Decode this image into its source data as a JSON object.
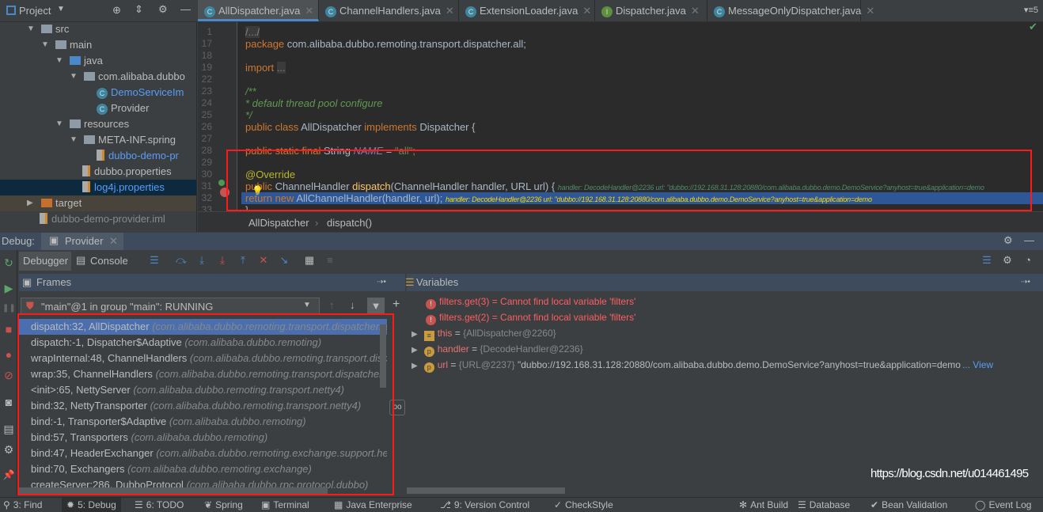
{
  "project": {
    "title": "Project",
    "tree": [
      {
        "label": "src",
        "indent": 1,
        "icon": "folder",
        "open": true
      },
      {
        "label": "main",
        "indent": 2,
        "icon": "folder",
        "open": true
      },
      {
        "label": "java",
        "indent": 3,
        "icon": "folder-blue",
        "open": true
      },
      {
        "label": "com.alibaba.dubbo",
        "indent": 4,
        "icon": "package",
        "open": true
      },
      {
        "label": "DemoServiceIm",
        "indent": 5,
        "icon": "class",
        "color": "#589df6"
      },
      {
        "label": "Provider",
        "indent": 5,
        "icon": "class"
      },
      {
        "label": "resources",
        "indent": 3,
        "icon": "folder",
        "open": true
      },
      {
        "label": "META-INF.spring",
        "indent": 4,
        "icon": "package",
        "open": true
      },
      {
        "label": "dubbo-demo-pr",
        "indent": 5,
        "icon": "xml",
        "color": "#589df6"
      },
      {
        "label": "dubbo.properties",
        "indent": 4,
        "icon": "properties"
      },
      {
        "label": "log4j.properties",
        "indent": 4,
        "icon": "properties",
        "selected": true,
        "color": "#589df6"
      },
      {
        "label": "target",
        "indent": 1,
        "icon": "folder-orange",
        "open": false,
        "excluded": true
      },
      {
        "label": "dubbo-demo-provider.iml",
        "indent": 1,
        "icon": "file",
        "color": "#888"
      }
    ]
  },
  "editor": {
    "tabs": [
      {
        "label": "AllDispatcher.java",
        "active": true
      },
      {
        "label": "ChannelHandlers.java"
      },
      {
        "label": "ExtensionLoader.java"
      },
      {
        "label": "Dispatcher.java",
        "interface": true
      },
      {
        "label": "MessageOnlyDispatcher.java"
      }
    ],
    "tab_count": "5",
    "lines": [
      {
        "n": "1",
        "tokens": [
          [
            "fold",
            "/.../"
          ]
        ]
      },
      {
        "n": "17",
        "tokens": [
          [
            "kw",
            "package "
          ],
          [
            "pl",
            "com.alibaba.dubbo.remoting.transport.dispatcher.all;"
          ]
        ]
      },
      {
        "n": "18",
        "tokens": []
      },
      {
        "n": "19",
        "tokens": [
          [
            "kw",
            "import "
          ],
          [
            "fold",
            "..."
          ]
        ]
      },
      {
        "n": "22",
        "tokens": []
      },
      {
        "n": "23",
        "tokens": [
          [
            "cm",
            "/**"
          ]
        ]
      },
      {
        "n": "24",
        "tokens": [
          [
            "cm",
            " * default thread pool configure"
          ]
        ]
      },
      {
        "n": "25",
        "tokens": [
          [
            "cm",
            " */"
          ]
        ]
      },
      {
        "n": "26",
        "tokens": [
          [
            "kw",
            "public class "
          ],
          [
            "pl",
            "AllDispatcher "
          ],
          [
            "kw",
            "implements "
          ],
          [
            "pl",
            "Dispatcher {"
          ]
        ]
      },
      {
        "n": "27",
        "tokens": []
      },
      {
        "n": "28",
        "tokens": [
          [
            "kw",
            "    public static final "
          ],
          [
            "pl",
            "String "
          ],
          [
            "it",
            "NAME"
          ],
          [
            "pl",
            " = "
          ],
          [
            "str",
            "\"all\""
          ],
          [
            "kw",
            ";"
          ]
        ]
      },
      {
        "n": "29",
        "tokens": []
      },
      {
        "n": "30",
        "tokens": [
          [
            "an",
            "    @Override"
          ]
        ]
      },
      {
        "n": "31",
        "tokens": [
          [
            "kw",
            "    public "
          ],
          [
            "pl",
            "ChannelHandler "
          ],
          [
            "fn",
            "dispatch"
          ],
          [
            "pl",
            "(ChannelHandler handler, URL url) {  "
          ],
          [
            "inl",
            "handler: DecodeHandler@2236  url: \"dubbo://192.168.31.128:20880/com.alibaba.dubbo.demo.DemoService?anyhost=true&application=demo"
          ]
        ]
      },
      {
        "n": "32",
        "highlight": true,
        "tokens": [
          [
            "kw",
            "        return new "
          ],
          [
            "pl",
            "AllChannelHandler(handler, url);  "
          ],
          [
            "inly",
            "handler: DecodeHandler@2236  url: \"dubbo://192.168.31.128:20880/com.alibaba.dubbo.demo.DemoService?anyhost=true&application=demo"
          ]
        ]
      },
      {
        "n": "33",
        "tokens": [
          [
            "pl",
            "    }"
          ]
        ]
      }
    ],
    "breadcrumb": [
      "AllDispatcher",
      "dispatch()"
    ]
  },
  "debug": {
    "label": "Debug:",
    "config_tab": "Provider",
    "tabs": {
      "debugger": "Debugger",
      "console": "Console"
    },
    "frames": {
      "title": "Frames",
      "thread": "\"main\"@1 in group \"main\": RUNNING",
      "items": [
        {
          "method": "dispatch:32, AllDispatcher",
          "pkg": "(com.alibaba.dubbo.remoting.transport.dispatcher.all)",
          "selected": true
        },
        {
          "method": "dispatch:-1, Dispatcher$Adaptive",
          "pkg": "(com.alibaba.dubbo.remoting)"
        },
        {
          "method": "wrapInternal:48, ChannelHandlers",
          "pkg": "(com.alibaba.dubbo.remoting.transport.dispatcher)"
        },
        {
          "method": "wrap:35, ChannelHandlers",
          "pkg": "(com.alibaba.dubbo.remoting.transport.dispatcher)"
        },
        {
          "method": "<init>:65, NettyServer",
          "pkg": "(com.alibaba.dubbo.remoting.transport.netty4)"
        },
        {
          "method": "bind:32, NettyTransporter",
          "pkg": "(com.alibaba.dubbo.remoting.transport.netty4)"
        },
        {
          "method": "bind:-1, Transporter$Adaptive",
          "pkg": "(com.alibaba.dubbo.remoting)"
        },
        {
          "method": "bind:57, Transporters",
          "pkg": "(com.alibaba.dubbo.remoting)"
        },
        {
          "method": "bind:47, HeaderExchanger",
          "pkg": "(com.alibaba.dubbo.remoting.exchange.support.header)"
        },
        {
          "method": "bind:70, Exchangers",
          "pkg": "(com.alibaba.dubbo.remoting.exchange)"
        },
        {
          "method": "createServer:286, DubboProtocol",
          "pkg": "(com.alibaba.dubbo.rpc.protocol.dubbo)"
        }
      ]
    },
    "variables": {
      "title": "Variables",
      "items": [
        {
          "kind": "error",
          "name": "filters.get(3)",
          "eq": " = ",
          "value": "Cannot find local variable 'filters'"
        },
        {
          "kind": "error",
          "name": "filters.get(2)",
          "eq": " = ",
          "value": "Cannot find local variable 'filters'"
        },
        {
          "kind": "field",
          "name": "this",
          "eq": " = ",
          "ref": "{AllDispatcher@2260}",
          "value": ""
        },
        {
          "kind": "param",
          "name": "handler",
          "eq": " = ",
          "ref": "{DecodeHandler@2236}",
          "value": ""
        },
        {
          "kind": "param",
          "name": "url",
          "eq": " = ",
          "ref": "{URL@2237}",
          "value": " \"dubbo://192.168.31.128:20880/com.alibaba.dubbo.demo.DemoService?anyhost=true&application=demo",
          "more": "... View"
        }
      ]
    }
  },
  "statusbar": {
    "left": [
      {
        "label": "3: Find",
        "icon": "search-icon"
      },
      {
        "label": "5: Debug",
        "icon": "bug-icon",
        "active": true
      },
      {
        "label": "6: TODO",
        "icon": "list-icon"
      },
      {
        "label": "Spring",
        "icon": "spring-icon"
      },
      {
        "label": "Terminal",
        "icon": "terminal-icon"
      },
      {
        "label": "Java Enterprise",
        "icon": "java-ee-icon"
      },
      {
        "label": "9: Version Control",
        "icon": "vcs-icon"
      },
      {
        "label": "CheckStyle",
        "icon": "checkstyle-icon"
      }
    ],
    "right": [
      {
        "label": "Ant Build",
        "icon": "ant-icon"
      },
      {
        "label": "Database",
        "icon": "database-icon"
      },
      {
        "label": "Bean Validation",
        "icon": "bean-icon"
      },
      {
        "label": "Event Log",
        "icon": "event-log-icon"
      }
    ]
  },
  "watermark": "https://blog.csdn.net/u014461495",
  "colors": {
    "accent": "#4a88c7",
    "selection": "#4b6eaf",
    "highlight_box": "#ff1a1a",
    "error": "#ff5e5e"
  }
}
